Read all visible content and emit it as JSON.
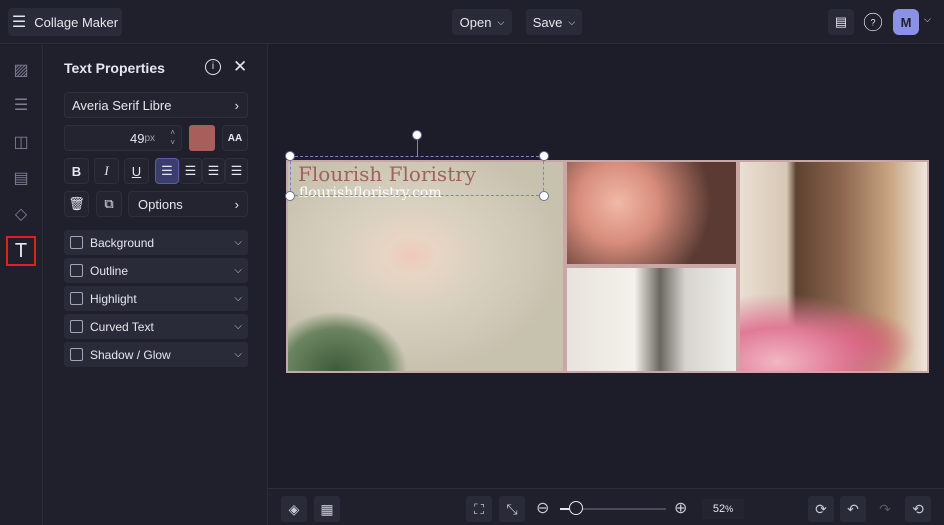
{
  "header": {
    "app_title": "Collage Maker",
    "open_label": "Open",
    "save_label": "Save",
    "avatar_initial": "M"
  },
  "panel": {
    "title": "Text Properties",
    "font": "Averia Serif Libre",
    "size_value": "49",
    "size_unit": "px",
    "text_color": "#a85f5c",
    "bold": "B",
    "italic": "I",
    "underline": "U",
    "options_label": "Options",
    "sections": [
      "Background",
      "Outline",
      "Highlight",
      "Curved Text",
      "Shadow / Glow"
    ]
  },
  "canvas": {
    "heading_text": "Flourish Floristry",
    "sub_text": "flourishfloristry.com"
  },
  "bottom": {
    "zoom_percent": "52",
    "zoom_unit": "%",
    "zoom_fraction": 0.15
  },
  "colors": {
    "accent": "#4a4c8a",
    "heading": "#a0625d"
  }
}
